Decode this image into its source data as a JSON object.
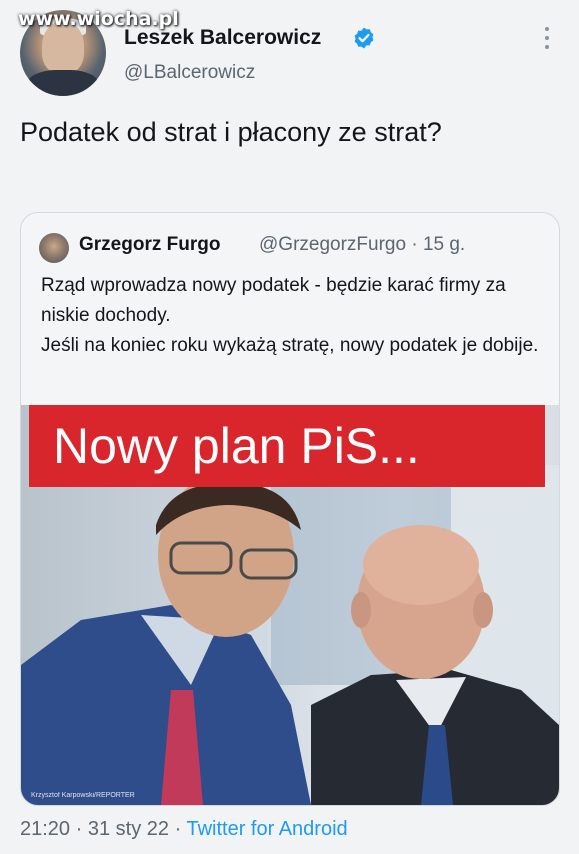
{
  "watermark": "www.wiocha.pl",
  "tweet": {
    "author_name": "Leszek Balcerowicz",
    "author_handle": "@LBalcerowicz",
    "text": "Podatek od strat i płacony ze strat?",
    "time": "21:20",
    "separator": "·",
    "date": "31 sty 22",
    "source": "Twitter for Android"
  },
  "quoted": {
    "author_name": "Grzegorz Furgo",
    "author_handle": "@GrzegorzFurgo",
    "age": "15 g.",
    "separator": "·",
    "text_line1": "Rząd wprowadza nowy podatek - będzie karać firmy za niskie dochody.",
    "text_line2": "Jeśli na koniec roku wykażą stratę, nowy podatek je dobije.",
    "image_banner": "Nowy plan PiS...",
    "image_credit": "Krzysztof Karpowski/REPORTER"
  },
  "colors": {
    "accent": "#1d9bf0",
    "banner_red": "#d9262c",
    "muted_text": "#5b6670"
  },
  "icons": {
    "verified": "verified-badge-icon",
    "more": "more-vertical-icon"
  }
}
